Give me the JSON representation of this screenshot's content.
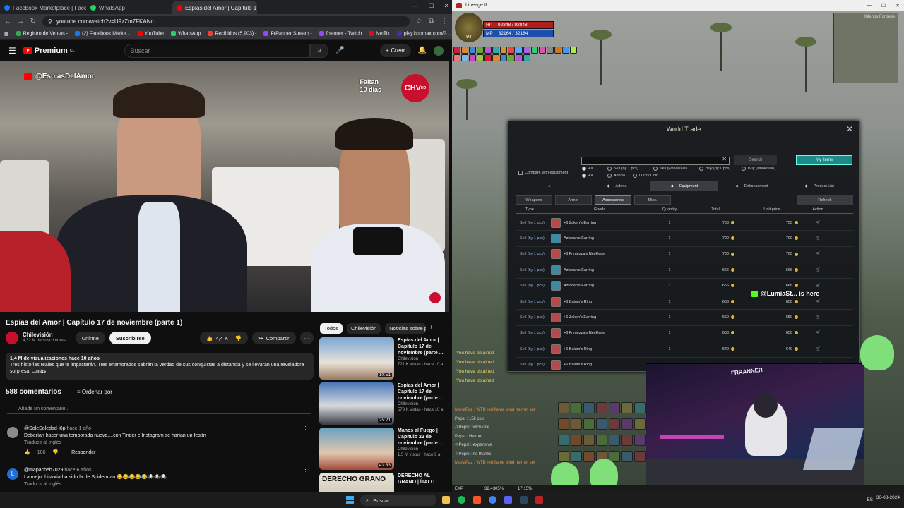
{
  "browser": {
    "tabs": [
      {
        "label": "Facebook Marketplace | Facebook",
        "color": "#1877f2"
      },
      {
        "label": "WhatsApp",
        "color": "#25d366"
      },
      {
        "label": "Espías del Amor | Capítulo 17 d",
        "color": "#ff0000",
        "active": true
      }
    ],
    "url": "youtube.com/watch?v=U9zZm7FKANc",
    "bookmarks": [
      "Registro de Ventas -",
      "(2) Facebook Marke...",
      "YouTube",
      "WhatsApp",
      "Recibidos (5,903) - ",
      "FrRanner Stream -",
      "frranner - Twitch",
      "Netflix",
      "play.hbomax.com/?..."
    ]
  },
  "youtube": {
    "logo": "Premium",
    "logo_suffix": "CL",
    "search_placeholder": "Buscar",
    "create_label": "Crear",
    "player": {
      "handle": "@EspiasDelAmor",
      "faltan": "Faltan",
      "dias": "10 días",
      "network": "CHV",
      "hd": "HD"
    },
    "title": "Espías del Amor | Capítulo 17 de noviembre (parte 1)",
    "channel": {
      "name": "Chilevisión",
      "subs": "4,32 M de suscriptores",
      "join": "Unirme",
      "subscribe": "Suscribirse"
    },
    "likes": "4,4 K",
    "share": "Compartir",
    "description": {
      "stats": "1,4 M de visualizaciones  hace 10 años",
      "text": "Tres historias reales que te impactarán. Tres enamorados sabrán la verdad de sus conquistas a distancia y se llevarán una reveladora sorpresa.",
      "more": "...más"
    },
    "comments": {
      "count": "588 comentarios",
      "sort": "Ordenar por",
      "add": "Añade un comentario...",
      "items": [
        {
          "author": "@SoleSoledad-j6p",
          "time": "hace 1 año",
          "text": "Deberían hacer una temporada nueva....con Tinder e Instagram se harían un festín",
          "translate": "Traducir al inglés",
          "likes": "106",
          "reply": "Responder",
          "avatar_color": "#8b8b8b"
        },
        {
          "author": "@mapacheb7029",
          "time": "hace 6 años",
          "text": "La mejor historia ha sido la de Spiderman 😂😂😂😂😂🕷🕷🕷",
          "translate": "Traducir al inglés",
          "avatar_color": "#1e6fd9",
          "initial": "L"
        }
      ]
    },
    "chips": [
      "Todos",
      "Chilevisión",
      "Noticias sobre p"
    ],
    "recommendations": [
      {
        "title": "Espías del Amor | Capítulo 17 de noviembre (parte ...",
        "channel": "Chilevisión",
        "meta": "721 K vistas · hace 10 a",
        "duration": "10:51"
      },
      {
        "title": "Espías del Amor | Capítulo 17 de noviembre (parte ...",
        "channel": "Chilevisión",
        "meta": "578 K vistas · hace 10 a",
        "duration": "25:21"
      },
      {
        "title": "Manos al Fuego | Capítulo 22 de noviembre (parte ...",
        "channel": "Chilevisión",
        "meta": "1,5 M vistas · hace 9 a",
        "duration": "43:33"
      },
      {
        "title": "DERECHO AL GRANO | ÍTALO",
        "channel": "",
        "meta": "",
        "duration": "",
        "thumb_text": "DERECHO GRANO"
      }
    ]
  },
  "game": {
    "window_title": "Lineage II",
    "level": "94",
    "hp": "92848 / 92848",
    "mp": "32164 / 32164",
    "hp_label": "HP",
    "mp_label": "MP",
    "minimap_label": "Xilenos Fortress",
    "world_trade": {
      "title": "World Trade",
      "search_btn": "Search",
      "my_items": "My items",
      "compare": "Compare with equipment",
      "filters": [
        "All",
        "Sell (by 1 pcs)",
        "Sell (wholesale)",
        "Buy (by 1 pcs)",
        "Buy (wholesale)"
      ],
      "filters2": [
        "All",
        "Adena",
        "Lucky Coin"
      ],
      "categories": [
        "Adena",
        "Equipment",
        "Enhancement",
        "Product List"
      ],
      "subtabs": [
        "Weapons",
        "Armor",
        "Accessories",
        "Misc."
      ],
      "refresh": "Refresh",
      "headers": [
        "Type",
        "Goods",
        "Quantity",
        "Total",
        "Unit price",
        "Action"
      ],
      "rows": [
        {
          "type": "Sell (by 1 pcs)",
          "goods": "+6 Zaken's Earring",
          "qty": "1",
          "total": "750",
          "unit": "750",
          "color": "#b64a4a"
        },
        {
          "type": "Sell (by 1 pcs)",
          "goods": "Aztacan's Earring",
          "qty": "1",
          "total": "700",
          "unit": "700",
          "color": "#3d8aa0"
        },
        {
          "type": "Sell (by 1 pcs)",
          "goods": "+6 Frintezza's Necklace",
          "qty": "1",
          "total": "700",
          "unit": "700",
          "color": "#b64a4a"
        },
        {
          "type": "Sell (by 1 pcs)",
          "goods": "Aztacan's Earring",
          "qty": "1",
          "total": "666",
          "unit": "666",
          "color": "#3d8aa0"
        },
        {
          "type": "Sell (by 1 pcs)",
          "goods": "Aztacan's Earring",
          "qty": "1",
          "total": "666",
          "unit": "666",
          "color": "#3d8aa0"
        },
        {
          "type": "Sell (by 1 pcs)",
          "goods": "+6 Baium's Ring",
          "qty": "1",
          "total": "650",
          "unit": "650",
          "color": "#b64a4a"
        },
        {
          "type": "Sell (by 1 pcs)",
          "goods": "+6 Zaken's Earring",
          "qty": "1",
          "total": "650",
          "unit": "650",
          "color": "#b64a4a"
        },
        {
          "type": "Sell (by 1 pcs)",
          "goods": "+6 Frintezza's Necklace",
          "qty": "1",
          "total": "650",
          "unit": "650",
          "color": "#b64a4a"
        },
        {
          "type": "Sell (by 1 pcs)",
          "goods": "+6 Baium's Ring",
          "qty": "1",
          "total": "640",
          "unit": "640",
          "color": "#b64a4a"
        },
        {
          "type": "Sell (by 1 pcs)",
          "goods": "+6 Baium's Ring",
          "qty": "1",
          "total": "",
          "unit": "",
          "color": "#b64a4a"
        }
      ]
    },
    "system_messages": [
      "You have obtained",
      "You have obtained",
      "You have obtained",
      "You have obtained"
    ],
    "chat": [
      {
        "text": "MariaPaz : WTB red flame wind helmet set",
        "cls": "c1"
      },
      {
        "text": "Pepsi : 15k cols",
        "cls": ""
      },
      {
        "text": "->Pepsi : wich one",
        "cls": ""
      },
      {
        "text": "Pepsi : Helmet",
        "cls": ""
      },
      {
        "text": "->Pepsi : expensive",
        "cls": ""
      },
      {
        "text": "->Pepsi : no thanks",
        "cls": ""
      },
      {
        "text": "MariaPaz : WTB red flame wind helmet set",
        "cls": "c1"
      }
    ],
    "exp_label": "EXP",
    "exp_value": "32.4305%",
    "exp_value2": "17.15%",
    "overlay_tag": "@LumiaSt... is here",
    "webcam_label": "FRRANNER"
  },
  "taskbar": {
    "search": "Buscar",
    "lang": "ES",
    "date": "30-08-2024"
  }
}
